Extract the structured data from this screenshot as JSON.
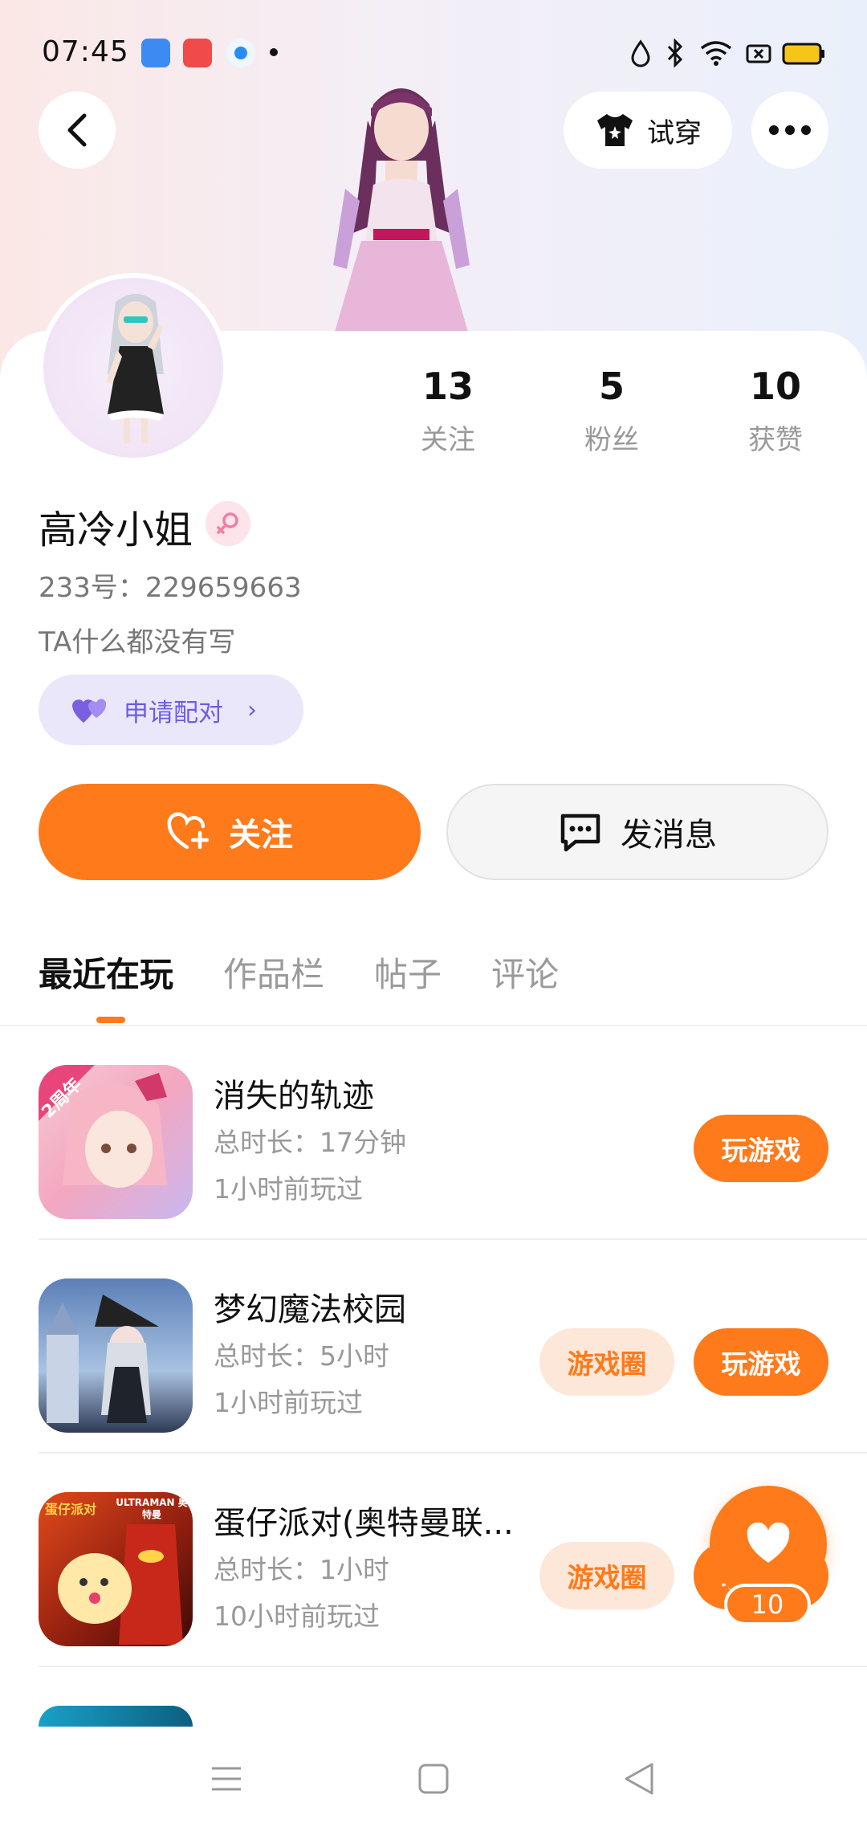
{
  "status_bar": {
    "time": "07:45",
    "apps": [
      "blue-app-icon",
      "red-app-icon",
      "blue-circle-app-icon"
    ],
    "icons": [
      "data-drop-icon",
      "bluetooth-icon",
      "wifi-icon",
      "battery-saver-icon",
      "battery-icon"
    ],
    "battery_color": "#f5c518"
  },
  "header": {
    "back_icon": "back-arrow-icon",
    "try_on_label": "试穿",
    "try_on_icon": "shirt-icon",
    "more_icon": "more-dots-icon"
  },
  "profile": {
    "stats": [
      {
        "value": "13",
        "label": "关注"
      },
      {
        "value": "5",
        "label": "粉丝"
      },
      {
        "value": "10",
        "label": "获赞"
      }
    ],
    "nickname": "高冷小姐",
    "gender_icon": "female-gender-icon",
    "uid": "233号：229659663",
    "bio": "TA什么都没有写",
    "pair_label": "申请配对",
    "follow_label": "关注",
    "message_label": "发消息"
  },
  "tabs": [
    {
      "label": "最近在玩",
      "active": true
    },
    {
      "label": "作品栏",
      "active": false
    },
    {
      "label": "帖子",
      "active": false
    },
    {
      "label": "评论",
      "active": false
    }
  ],
  "games": [
    {
      "name": "消失的轨迹",
      "duration": "总时长：17分钟",
      "last_played": "1小时前玩过",
      "badge": "2周年",
      "has_circle": false,
      "play_label": "玩游戏"
    },
    {
      "name": "梦幻魔法校园",
      "duration": "总时长：5小时",
      "last_played": "1小时前玩过",
      "has_circle": true,
      "circle_label": "游戏圈",
      "play_label": "玩游戏"
    },
    {
      "name": "蛋仔派对(奥特曼联...",
      "duration": "总时长：1小时",
      "last_played": "10小时前玩过",
      "has_circle": true,
      "circle_label": "游戏圈",
      "play_label": "玩游戏",
      "icon_text_top_left": "蛋仔派对",
      "icon_text_top_right": "ULTRAMAN 奥特曼"
    }
  ],
  "like_fab": {
    "icon": "heart-icon",
    "count": "10"
  },
  "nav": [
    "menu-icon",
    "home-square-icon",
    "back-triangle-icon"
  ],
  "colors": {
    "accent": "#ff7a1a",
    "pair_purple": "#6c5ce7"
  }
}
